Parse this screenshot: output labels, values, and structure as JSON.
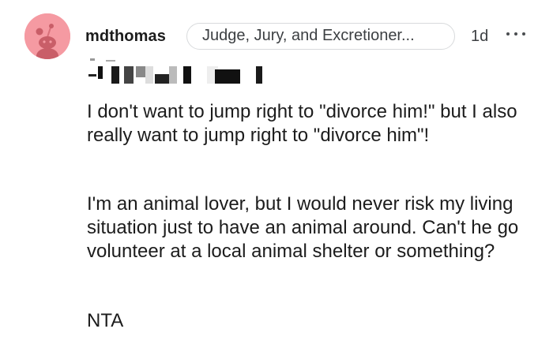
{
  "comment": {
    "author": "mdthomas",
    "flair": "Judge, Jury, and Excretioner...",
    "age": "1d",
    "more_icon": "ellipsis-icon",
    "avatar_icon": "reddit-snoo-avatar",
    "paragraphs": [
      "I don't want to jump right to \"divorce him!\" but I also really want to jump right to \"divorce him\"!",
      "I'm an animal lover, but I would never risk my living situation just to have an animal around. Can't he go volunteer at a local animal shelter or something?",
      "NTA"
    ]
  },
  "colors": {
    "avatar_bg": "#f59aa2",
    "text": "#1c1c1c",
    "flair_border": "#d8dadc"
  }
}
